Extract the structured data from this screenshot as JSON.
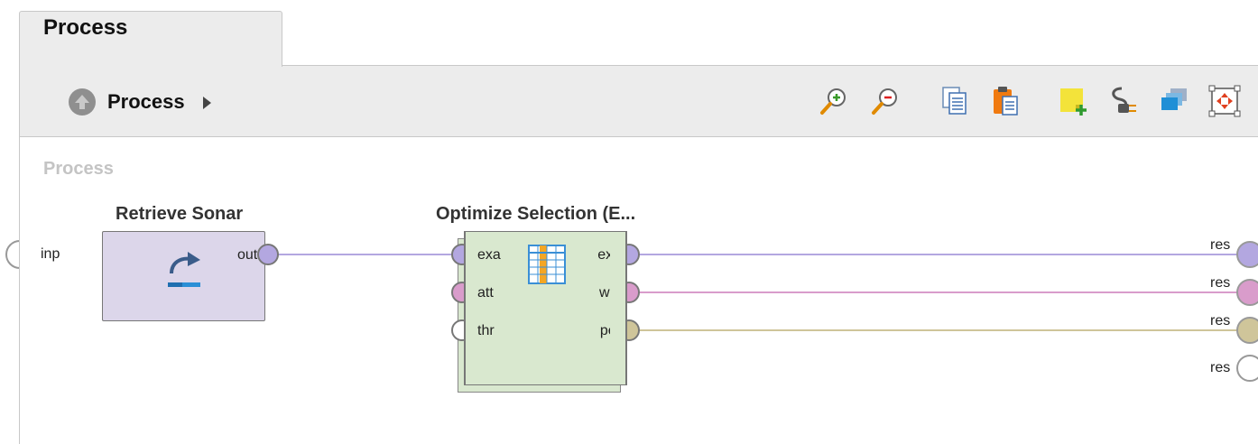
{
  "tab": {
    "title": "Process"
  },
  "toolbar": {
    "breadcrumb": "Process",
    "icons": [
      "zoom-in-icon",
      "zoom-out-icon",
      "copy-icon",
      "paste-icon",
      "add-note-icon",
      "auto-wire-icon",
      "arrange-icon",
      "fit-view-icon"
    ]
  },
  "canvas": {
    "label": "Process"
  },
  "left_ports": [
    {
      "label": "inp"
    }
  ],
  "operators": {
    "retrieve": {
      "title": "Retrieve Sonar",
      "out_port": "out",
      "color": "#dcd6ea"
    },
    "optimize": {
      "title": "Optimize Selection (E...",
      "in_ports": [
        "exa",
        "att",
        "thr"
      ],
      "out_ports": [
        "exa",
        "wei",
        "per"
      ],
      "color": "#d9e8cf"
    }
  },
  "result_ports": [
    {
      "label": "res"
    },
    {
      "label": "res"
    },
    {
      "label": "res"
    },
    {
      "label": "res"
    }
  ],
  "colors": {
    "example_set": "#b3a7e0",
    "weights": "#d99ccb",
    "performance": "#cfc59a",
    "empty_port": "#ffffff"
  }
}
